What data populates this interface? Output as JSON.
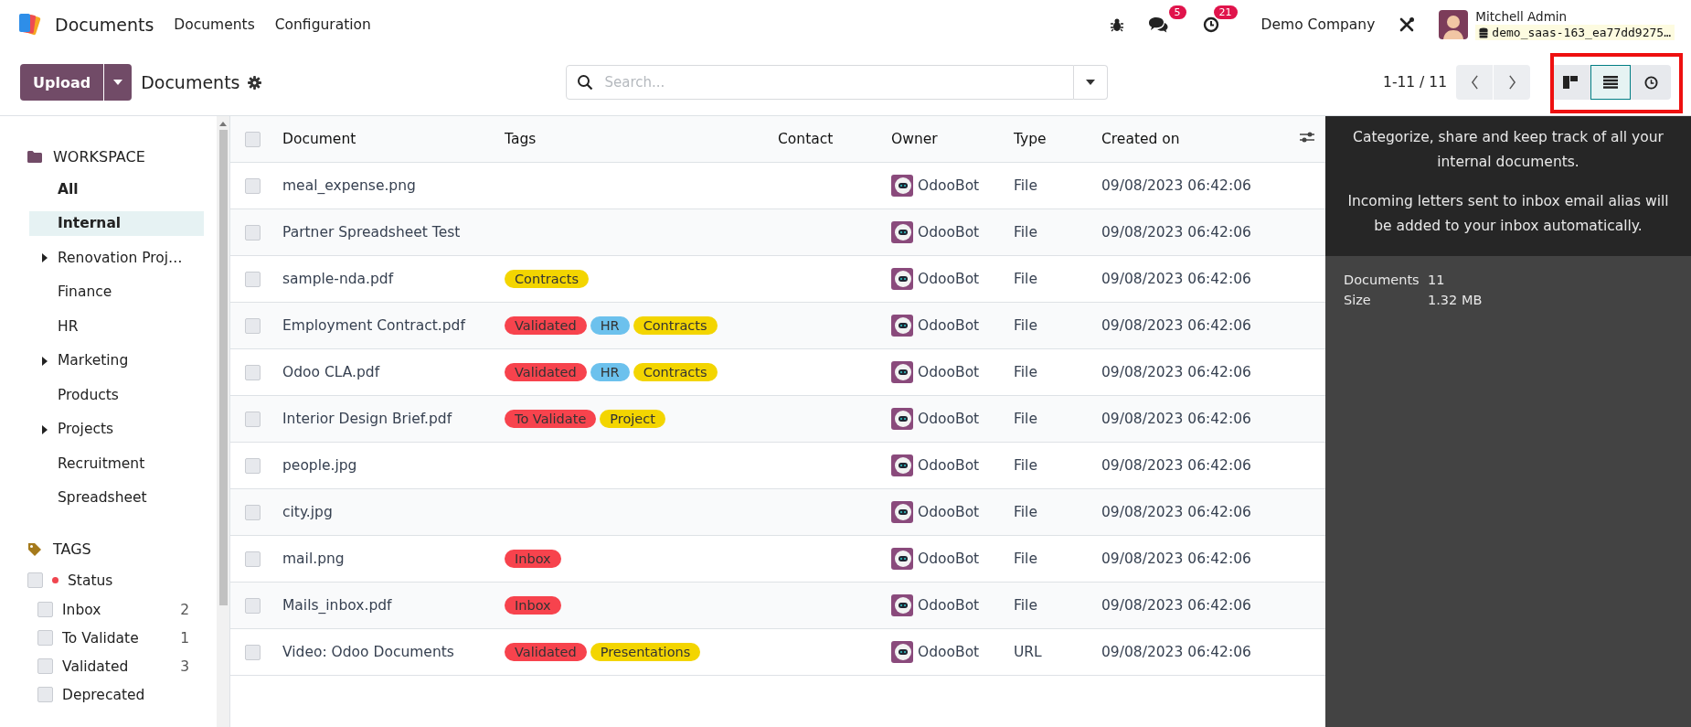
{
  "navbar": {
    "app_name": "Documents",
    "menu": [
      {
        "label": "Documents"
      },
      {
        "label": "Configuration"
      }
    ],
    "messages_badge": "5",
    "activities_badge": "21",
    "company": "Demo Company",
    "user_name": "Mitchell Admin",
    "database": "demo_saas-163_ea77dd9275…"
  },
  "control_panel": {
    "upload_label": "Upload",
    "breadcrumb": "Documents",
    "search": {
      "placeholder": "Search..."
    },
    "pager": "1-11 / 11",
    "views": [
      {
        "kind": "kanban",
        "selected": false
      },
      {
        "kind": "list",
        "selected": true
      },
      {
        "kind": "activity",
        "selected": false
      }
    ]
  },
  "sidebar": {
    "workspace_title": "WORKSPACE",
    "folders": [
      {
        "label": "All",
        "kind": "all",
        "selected": false
      },
      {
        "label": "Internal",
        "kind": "folder",
        "selected": true
      },
      {
        "label": "Renovation Proj…",
        "kind": "parent",
        "selected": false
      },
      {
        "label": "Finance",
        "kind": "folder",
        "selected": false
      },
      {
        "label": "HR",
        "kind": "folder",
        "selected": false
      },
      {
        "label": "Marketing",
        "kind": "parent",
        "selected": false
      },
      {
        "label": "Products",
        "kind": "folder",
        "selected": false
      },
      {
        "label": "Projects",
        "kind": "parent",
        "selected": false
      },
      {
        "label": "Recruitment",
        "kind": "folder",
        "selected": false
      },
      {
        "label": "Spreadsheet",
        "kind": "folder",
        "selected": false
      }
    ],
    "tags_title": "TAGS",
    "tag_groups": [
      {
        "label": "Status",
        "color": "#f0454f",
        "checked": false,
        "tags": [
          {
            "label": "Inbox",
            "count": "2",
            "checked": false
          },
          {
            "label": "To Validate",
            "count": "1",
            "checked": false
          },
          {
            "label": "Validated",
            "count": "3",
            "checked": false
          },
          {
            "label": "Deprecated",
            "checked": false
          }
        ]
      }
    ]
  },
  "table": {
    "select_all_checked": false,
    "columns": [
      "Document",
      "Tags",
      "Contact",
      "Owner",
      "Type",
      "Created on"
    ],
    "rows": [
      {
        "document": "meal_expense.png",
        "owner": "OdooBot",
        "type": "File",
        "created_on": "09/08/2023 06:42:06",
        "selected": false
      },
      {
        "document": "Partner Spreadsheet Test",
        "owner": "OdooBot",
        "type": "File",
        "created_on": "09/08/2023 06:42:06",
        "selected": false
      },
      {
        "document": "sample-nda.pdf",
        "tags": [
          {
            "label": "Contracts",
            "color": "#f3d500"
          }
        ],
        "owner": "OdooBot",
        "type": "File",
        "created_on": "09/08/2023 06:42:06",
        "selected": false
      },
      {
        "document": "Employment Contract.pdf",
        "tags": [
          {
            "label": "Validated",
            "color": "#f7434d"
          },
          {
            "label": "HR",
            "color": "#6cc1ed"
          },
          {
            "label": "Contracts",
            "color": "#f3d500"
          }
        ],
        "owner": "OdooBot",
        "type": "File",
        "created_on": "09/08/2023 06:42:06",
        "selected": false
      },
      {
        "document": "Odoo CLA.pdf",
        "tags": [
          {
            "label": "Validated",
            "color": "#f7434d"
          },
          {
            "label": "HR",
            "color": "#6cc1ed"
          },
          {
            "label": "Contracts",
            "color": "#f3d500"
          }
        ],
        "owner": "OdooBot",
        "type": "File",
        "created_on": "09/08/2023 06:42:06",
        "selected": false
      },
      {
        "document": "Interior Design Brief.pdf",
        "tags": [
          {
            "label": "To Validate",
            "color": "#f7434d"
          },
          {
            "label": "Project",
            "color": "#f3d500"
          }
        ],
        "owner": "OdooBot",
        "type": "File",
        "created_on": "09/08/2023 06:42:06",
        "selected": false
      },
      {
        "document": "people.jpg",
        "owner": "OdooBot",
        "type": "File",
        "created_on": "09/08/2023 06:42:06",
        "selected": false
      },
      {
        "document": "city.jpg",
        "owner": "OdooBot",
        "type": "File",
        "created_on": "09/08/2023 06:42:06",
        "selected": false
      },
      {
        "document": "mail.png",
        "tags": [
          {
            "label": "Inbox",
            "color": "#f7434d"
          }
        ],
        "owner": "OdooBot",
        "type": "File",
        "created_on": "09/08/2023 06:42:06",
        "selected": false
      },
      {
        "document": "Mails_inbox.pdf",
        "tags": [
          {
            "label": "Inbox",
            "color": "#f7434d"
          }
        ],
        "owner": "OdooBot",
        "type": "File",
        "created_on": "09/08/2023 06:42:06",
        "selected": false
      },
      {
        "document": "Video: Odoo Documents",
        "tags": [
          {
            "label": "Validated",
            "color": "#f7434d"
          },
          {
            "label": "Presentations",
            "color": "#f3d500"
          }
        ],
        "owner": "OdooBot",
        "type": "URL",
        "created_on": "09/08/2023 06:42:06",
        "selected": false
      }
    ]
  },
  "info_panel": {
    "paragraphs": [
      "Categorize, share and keep track of all your internal documents.",
      "Incoming letters sent to inbox email alias will be added to your inbox automatically."
    ],
    "stats": [
      {
        "label": "Documents",
        "value": "11"
      },
      {
        "label": "Size",
        "value": "1.32 MB"
      }
    ]
  }
}
